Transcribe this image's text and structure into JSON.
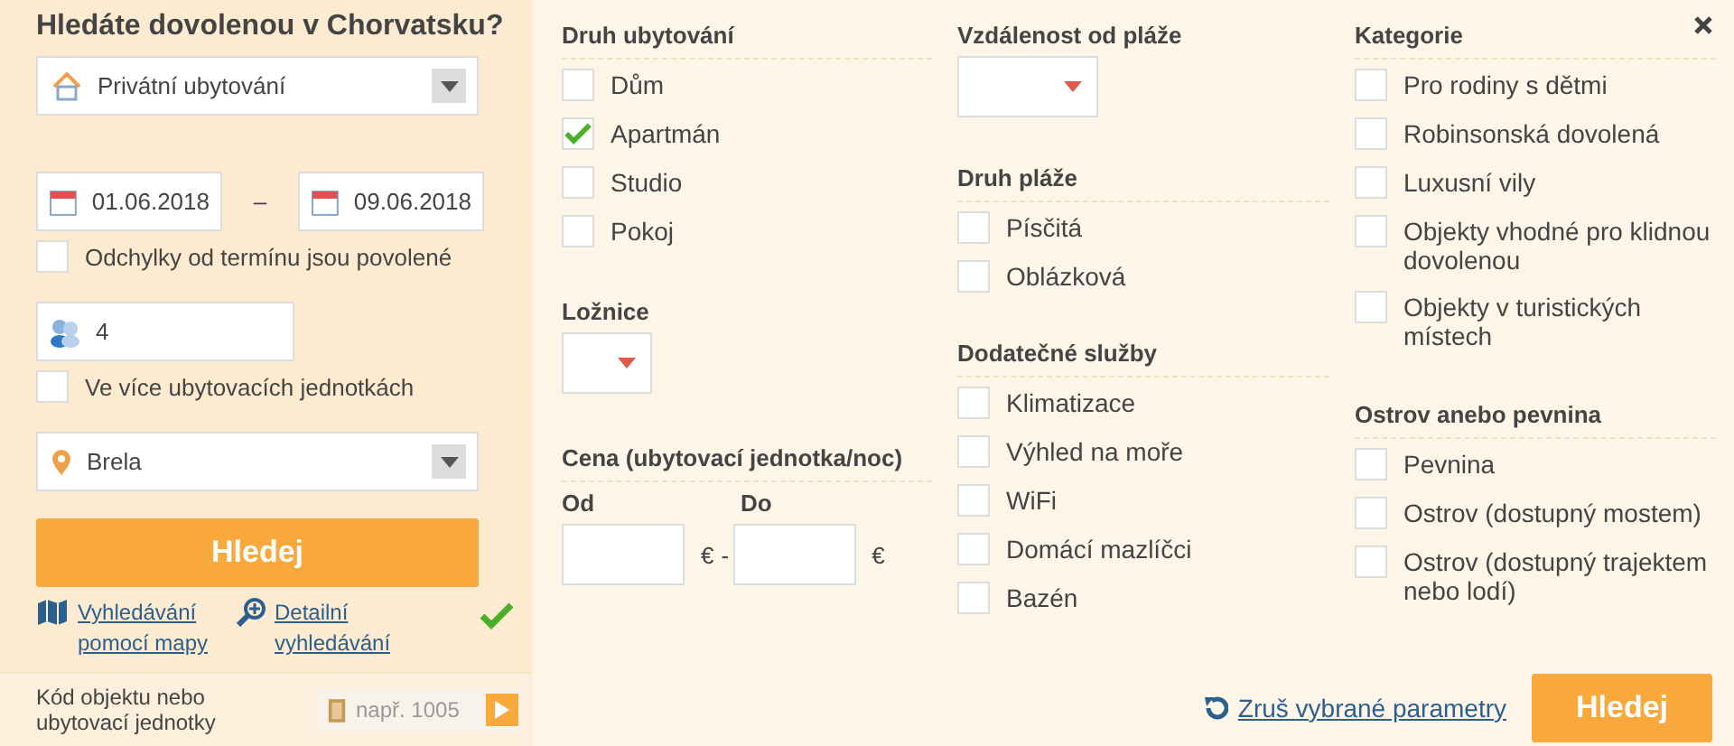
{
  "sidebar": {
    "title": "Hledáte dovolenou v Chorvatsku?",
    "accommodation": {
      "value": "Privátní ubytování"
    },
    "date_from": {
      "value": "01.06.2018"
    },
    "date_separator": "–",
    "date_to": {
      "value": "09.06.2018"
    },
    "flexible_dates": {
      "label": "Odchylky od termínu jsou povolené",
      "checked": false
    },
    "guests": {
      "value": "4"
    },
    "multiple_units": {
      "label": "Ve více ubytovacích jednotkách",
      "checked": false
    },
    "location": {
      "value": "Brela"
    },
    "search_button": "Hledej",
    "links": [
      {
        "kind": "map",
        "label": "Vyhledávání pomocí mapy"
      },
      {
        "kind": "detail",
        "label": "Detailní vyhledávání",
        "active": true
      }
    ],
    "code_search": {
      "label": "Kód objektu nebo ubytovací jednotky",
      "placeholder": "např. 1005"
    }
  },
  "filters": {
    "columns": [
      [
        {
          "kind": "checkboxes",
          "title": "Druh ubytování",
          "items": [
            {
              "label": "Dům",
              "checked": false
            },
            {
              "label": "Apartmán",
              "checked": true
            },
            {
              "label": "Studio",
              "checked": false
            },
            {
              "label": "Pokoj",
              "checked": false
            }
          ]
        },
        {
          "kind": "select",
          "title": "Ložnice"
        },
        {
          "kind": "price",
          "title": "Cena (ubytovací jednotka/noc)",
          "from_label": "Od",
          "to_label": "Do",
          "currency": "€",
          "separator": "-"
        }
      ],
      [
        {
          "kind": "select",
          "title": "Vzdálenost od pláže"
        },
        {
          "kind": "checkboxes",
          "title": "Druh pláže",
          "items": [
            {
              "label": "Písčitá",
              "checked": false
            },
            {
              "label": "Oblázková",
              "checked": false
            }
          ]
        },
        {
          "kind": "checkboxes",
          "title": "Dodatečné služby",
          "items": [
            {
              "label": "Klimatizace",
              "checked": false
            },
            {
              "label": "Výhled na moře",
              "checked": false
            },
            {
              "label": "WiFi",
              "checked": false
            },
            {
              "label": "Domácí mazlíčci",
              "checked": false
            },
            {
              "label": "Bazén",
              "checked": false
            }
          ]
        }
      ],
      [
        {
          "kind": "checkboxes",
          "title": "Kategorie",
          "items": [
            {
              "label": "Pro rodiny s dětmi",
              "checked": false
            },
            {
              "label": "Robinsonská dovolená",
              "checked": false
            },
            {
              "label": "Luxusní vily",
              "checked": false
            },
            {
              "label": "Objekty vhodné pro klidnou dovolenou",
              "checked": false
            },
            {
              "label": "Objekty v turistických místech",
              "checked": false
            }
          ]
        },
        {
          "kind": "checkboxes",
          "title": "Ostrov anebo pevnina",
          "items": [
            {
              "label": "Pevnina",
              "checked": false
            },
            {
              "label": "Ostrov (dostupný mostem)",
              "checked": false
            },
            {
              "label": "Ostrov (dostupný trajektem nebo lodí)",
              "checked": false
            }
          ]
        }
      ]
    ],
    "reset_link": "Zruš vybrané parametry",
    "search_button": "Hledej"
  }
}
